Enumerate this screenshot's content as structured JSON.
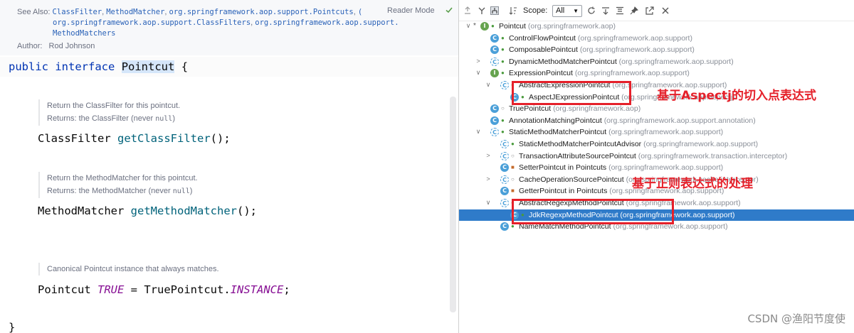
{
  "editor": {
    "doc": {
      "see_also_label": "See Also:",
      "see_also_links": [
        "ClassFilter",
        "MethodMatcher",
        "org.springframework.aop.support.Pointcuts",
        "(",
        "org.springframework.aop.support.ClassFilters",
        "org.springframework.aop.support.",
        "MethodMatchers"
      ],
      "author_label": "Author:",
      "author": "Rod Johnson",
      "reader_mode": "Reader Mode"
    },
    "declaration": {
      "kw_public": "public",
      "kw_interface": "interface",
      "name": "Pointcut",
      "brace_open": "{"
    },
    "methods": [
      {
        "doc_line1": "Return the ClassFilter for this pointcut.",
        "doc_line2_prefix": "Returns: the ClassFilter (never ",
        "doc_line2_code": "null",
        "doc_line2_suffix": ")",
        "return_type": "ClassFilter",
        "name": "getClassFilter",
        "tail": "();"
      },
      {
        "doc_line1": "Return the MethodMatcher for this pointcut.",
        "doc_line2_prefix": "Returns: the MethodMatcher (never ",
        "doc_line2_code": "null",
        "doc_line2_suffix": ")",
        "return_type": "MethodMatcher",
        "name": "getMethodMatcher",
        "tail": "();"
      }
    ],
    "constant": {
      "doc_line1": "Canonical Pointcut instance that always matches.",
      "type": "Pointcut",
      "name": "TRUE",
      "eq": "=",
      "value_class": "TruePointcut.",
      "value_field": "INSTANCE",
      "semi": ";"
    },
    "brace_close": "}"
  },
  "hierarchy": {
    "toolbar": {
      "scope_label": "Scope:",
      "scope_value": "All"
    },
    "rows": [
      {
        "name": "Pointcut",
        "pkg": "(org.springframework.aop)",
        "chev": "∨",
        "star": "*",
        "icon": "I",
        "kind": "iface",
        "vis": "●"
      },
      {
        "name": "ControlFlowPointcut",
        "pkg": "(org.springframework.aop.support)",
        "chev": "",
        "icon": "C",
        "kind": "class",
        "vis": "●"
      },
      {
        "name": "ComposablePointcut",
        "pkg": "(org.springframework.aop.support)",
        "chev": "",
        "icon": "C",
        "kind": "class",
        "vis": "●"
      },
      {
        "name": "DynamicMethodMatcherPointcut",
        "pkg": "(org.springframework.aop.support)",
        "chev": ">",
        "icon": "C",
        "kind": "abstr",
        "vis": "●"
      },
      {
        "name": "ExpressionPointcut",
        "pkg": "(org.springframework.aop.support)",
        "chev": "∨",
        "icon": "I",
        "kind": "iface",
        "vis": "●"
      },
      {
        "name": "AbstractExpressionPointcut",
        "pkg": "(org.springframework.aop.support)",
        "chev": "∨",
        "icon": "C",
        "kind": "abstr",
        "vis": "●"
      },
      {
        "name": "AspectJExpressionPointcut",
        "pkg": "(org.springframework.aop.aspectj)",
        "chev": "",
        "icon": "C",
        "kind": "class",
        "vis": "●"
      },
      {
        "name": "TruePointcut",
        "pkg": "(org.springframework.aop)",
        "chev": "",
        "icon": "C",
        "kind": "class",
        "vis": "○"
      },
      {
        "name": "AnnotationMatchingPointcut",
        "pkg": "(org.springframework.aop.support.annotation)",
        "chev": "",
        "icon": "C",
        "kind": "class",
        "vis": "●"
      },
      {
        "name": "StaticMethodMatcherPointcut",
        "pkg": "(org.springframework.aop.support)",
        "chev": "∨",
        "icon": "C",
        "kind": "abstr",
        "vis": "●"
      },
      {
        "name": "StaticMethodMatcherPointcutAdvisor",
        "pkg": "(org.springframework.aop.support)",
        "chev": "",
        "icon": "C",
        "kind": "abstr",
        "vis": "●"
      },
      {
        "name": "TransactionAttributeSourcePointcut",
        "pkg": "(org.springframework.transaction.interceptor)",
        "chev": ">",
        "icon": "C",
        "kind": "abstr",
        "vis": "○"
      },
      {
        "name": "SetterPointcut in Pointcuts",
        "pkg": "(org.springframework.aop.support)",
        "chev": "",
        "icon": "C",
        "kind": "class",
        "vis": "■"
      },
      {
        "name": "CacheOperationSourcePointcut",
        "pkg": "(org.springframework.cache.interceptor)",
        "chev": ">",
        "icon": "C",
        "kind": "abstr",
        "vis": "○"
      },
      {
        "name": "GetterPointcut in Pointcuts",
        "pkg": "(org.springframework.aop.support)",
        "chev": "",
        "icon": "C",
        "kind": "class",
        "vis": "■"
      },
      {
        "name": "AbstractRegexpMethodPointcut",
        "pkg": "(org.springframework.aop.support)",
        "chev": "∨",
        "icon": "C",
        "kind": "abstr",
        "vis": "●"
      },
      {
        "name": "JdkRegexpMethodPointcut",
        "pkg": "(org.springframework.aop.support)",
        "chev": "",
        "icon": "C",
        "kind": "class",
        "vis": "●"
      },
      {
        "name": "NameMatchMethodPointcut",
        "pkg": "(org.springframework.aop.support)",
        "chev": "",
        "icon": "C",
        "kind": "class",
        "vis": "●"
      }
    ],
    "selected_index": 16,
    "annotations": {
      "aspectj": "基于Aspectj的切入点表达式",
      "regex": "基于正则表达式的处理"
    }
  },
  "watermark": "CSDN @渔阳节度使",
  "colors": {
    "keyword": "#0033b3",
    "method": "#00627a",
    "constant": "#871094",
    "selection": "#2f7bc9",
    "annotation_red": "#e5202a"
  }
}
